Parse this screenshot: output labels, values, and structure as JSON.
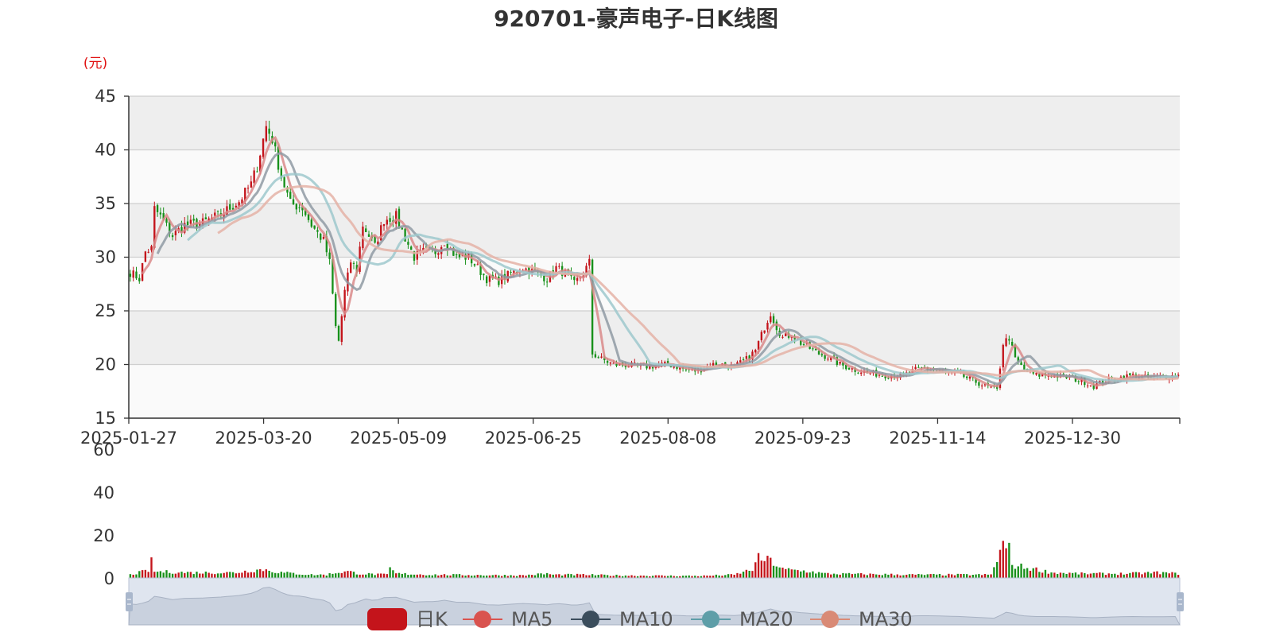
{
  "chart_data": {
    "type": "candlestick",
    "title": "920701-豪声电子-日K线图",
    "y_unit": "(元)",
    "ylim": [
      15,
      45
    ],
    "y_ticks": [
      15,
      20,
      25,
      30,
      35,
      40,
      45
    ],
    "x_tick_labels": [
      "2025-01-27",
      "2025-03-20",
      "2025-05-09",
      "2025-06-25",
      "2025-08-08",
      "2025-09-23",
      "2025-11-14",
      "2025-12-30"
    ],
    "volume_ylim": [
      0,
      60
    ],
    "volume_ticks": [
      0,
      20,
      40,
      60
    ],
    "grid": true,
    "legend": [
      "日K",
      "MA5",
      "MA10",
      "MA20",
      "MA30"
    ],
    "legend_position": "bottom",
    "price_keypoints": [
      [
        0,
        28.6
      ],
      [
        3,
        28.0
      ],
      [
        5,
        30.5
      ],
      [
        7,
        30.8
      ],
      [
        8,
        34.5
      ],
      [
        10,
        33.8
      ],
      [
        14,
        32.0
      ],
      [
        18,
        33.0
      ],
      [
        24,
        33.2
      ],
      [
        30,
        34.0
      ],
      [
        36,
        35.2
      ],
      [
        40,
        36.8
      ],
      [
        42,
        38.5
      ],
      [
        45,
        42.2
      ],
      [
        47,
        41.0
      ],
      [
        50,
        37.5
      ],
      [
        53,
        35.0
      ],
      [
        57,
        34.6
      ],
      [
        60,
        33.0
      ],
      [
        64,
        31.5
      ],
      [
        66,
        29.5
      ],
      [
        68,
        23.5
      ],
      [
        69,
        22.2
      ],
      [
        71,
        26.8
      ],
      [
        73,
        29.6
      ],
      [
        75,
        28.8
      ],
      [
        77,
        33.0
      ],
      [
        79,
        32.0
      ],
      [
        81,
        31.0
      ],
      [
        84,
        33.5
      ],
      [
        88,
        33.8
      ],
      [
        91,
        31.8
      ],
      [
        94,
        30.0
      ],
      [
        97,
        30.5
      ],
      [
        101,
        30.5
      ],
      [
        104,
        31.5
      ],
      [
        108,
        30.0
      ],
      [
        112,
        30.0
      ],
      [
        115,
        29.0
      ],
      [
        118,
        28.0
      ],
      [
        122,
        27.8
      ],
      [
        126,
        28.5
      ],
      [
        130,
        29.0
      ],
      [
        134,
        28.6
      ],
      [
        138,
        28.0
      ],
      [
        141,
        29.0
      ],
      [
        144,
        28.5
      ],
      [
        147,
        27.5
      ],
      [
        150,
        28.5
      ],
      [
        152,
        29.5
      ],
      [
        153,
        21.0
      ],
      [
        156,
        20.5
      ],
      [
        160,
        20.0
      ],
      [
        166,
        19.9
      ],
      [
        172,
        19.8
      ],
      [
        176,
        20.0
      ],
      [
        180,
        19.9
      ],
      [
        184,
        19.5
      ],
      [
        188,
        19.4
      ],
      [
        192,
        20.0
      ],
      [
        196,
        20.0
      ],
      [
        200,
        19.8
      ],
      [
        204,
        20.5
      ],
      [
        207,
        21.3
      ],
      [
        210,
        23.5
      ],
      [
        212,
        24.8
      ],
      [
        214,
        23.5
      ],
      [
        216,
        22.5
      ],
      [
        219,
        22.8
      ],
      [
        222,
        22.0
      ],
      [
        225,
        21.5
      ],
      [
        228,
        21.0
      ],
      [
        231,
        20.7
      ],
      [
        235,
        20.0
      ],
      [
        240,
        19.5
      ],
      [
        245,
        19.2
      ],
      [
        250,
        19.0
      ],
      [
        256,
        19.0
      ],
      [
        260,
        19.5
      ],
      [
        263,
        19.6
      ],
      [
        267,
        19.5
      ],
      [
        271,
        19.2
      ],
      [
        275,
        19.0
      ],
      [
        279,
        18.5
      ],
      [
        283,
        18.0
      ],
      [
        287,
        17.6
      ],
      [
        289,
        22.0
      ],
      [
        291,
        22.5
      ],
      [
        293,
        20.5
      ],
      [
        296,
        19.5
      ],
      [
        300,
        19.0
      ],
      [
        305,
        19.0
      ],
      [
        310,
        18.8
      ],
      [
        315,
        18.5
      ],
      [
        319,
        18.0
      ],
      [
        323,
        18.5
      ],
      [
        328,
        18.8
      ],
      [
        332,
        19.0
      ],
      [
        336,
        18.8
      ],
      [
        340,
        18.8
      ],
      [
        344,
        18.9
      ],
      [
        347,
        19.0
      ]
    ],
    "volume_keypoints": [
      [
        0,
        1.5
      ],
      [
        6,
        3.5
      ],
      [
        7,
        7.5
      ],
      [
        8,
        3.0
      ],
      [
        20,
        2.5
      ],
      [
        35,
        2.5
      ],
      [
        40,
        3.5
      ],
      [
        44,
        4.0
      ],
      [
        50,
        2.5
      ],
      [
        60,
        1.5
      ],
      [
        65,
        1.5
      ],
      [
        68,
        2.5
      ],
      [
        72,
        3.0
      ],
      [
        76,
        2.0
      ],
      [
        85,
        1.5
      ],
      [
        86,
        4.5
      ],
      [
        88,
        2.0
      ],
      [
        100,
        1.5
      ],
      [
        130,
        1.2
      ],
      [
        138,
        2.0
      ],
      [
        140,
        1.5
      ],
      [
        150,
        1.5
      ],
      [
        160,
        1.2
      ],
      [
        180,
        1.0
      ],
      [
        190,
        1.0
      ],
      [
        200,
        1.5
      ],
      [
        206,
        4.0
      ],
      [
        208,
        9.0
      ],
      [
        212,
        8.0
      ],
      [
        216,
        4.0
      ],
      [
        225,
        3.0
      ],
      [
        230,
        2.0
      ],
      [
        240,
        1.8
      ],
      [
        260,
        1.5
      ],
      [
        270,
        1.5
      ],
      [
        285,
        1.5
      ],
      [
        289,
        15.5
      ],
      [
        291,
        13.0
      ],
      [
        292,
        6.0
      ],
      [
        296,
        5.0
      ],
      [
        300,
        4.0
      ],
      [
        305,
        2.5
      ],
      [
        315,
        2.0
      ],
      [
        330,
        2.0
      ],
      [
        340,
        2.5
      ],
      [
        347,
        2.0
      ]
    ]
  }
}
